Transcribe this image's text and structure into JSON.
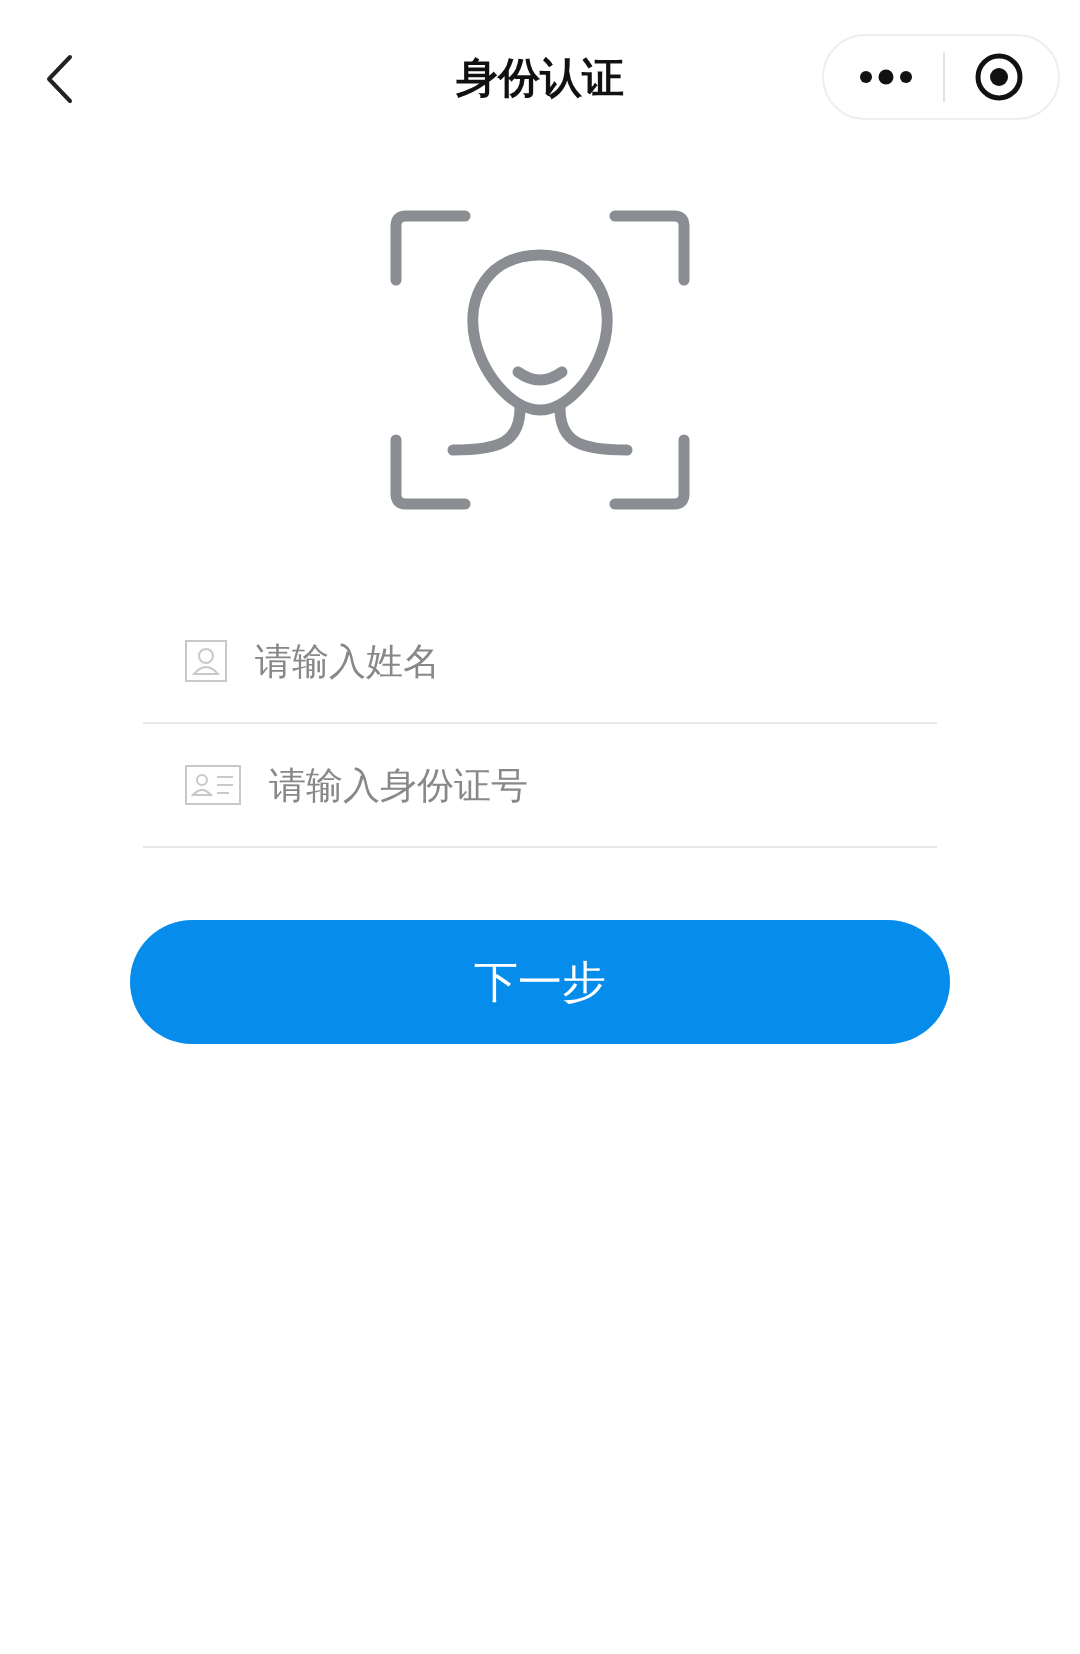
{
  "nav_bar": {
    "title": "身份认证"
  },
  "fields": [
    {
      "kind": "name",
      "placeholder": "请输入姓名"
    },
    {
      "kind": "id",
      "placeholder": "请输入身份证号"
    }
  ],
  "next_button": {
    "label": "下一步"
  }
}
